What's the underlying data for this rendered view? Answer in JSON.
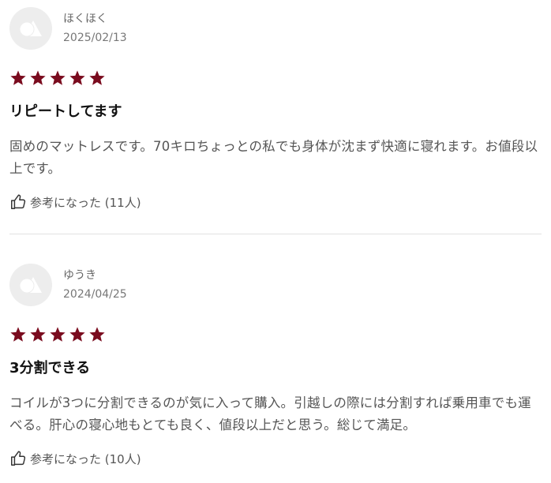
{
  "colors": {
    "star": "#7a0b1e",
    "avatar_bg": "#ededed",
    "avatar_icon": "#ffffff"
  },
  "reviews": [
    {
      "user": "ほくほく",
      "date": "2025/02/13",
      "rating": 5,
      "title": "リピートしてます",
      "body": "固めのマットレスです。70キロちょっとの私でも身体が沈まず快適に寝れます。お値段以上です。",
      "helpful_label": "参考になった (11人)",
      "icons": {
        "avatar": "default-avatar-icon",
        "helpful": "thumbs-up-icon"
      }
    },
    {
      "user": "ゆうき",
      "date": "2024/04/25",
      "rating": 5,
      "title": "3分割できる",
      "body": "コイルが3つに分割できるのが気に入って購入。引越しの際には分割すれば乗用車でも運べる。肝心の寝心地もとても良く、値段以上だと思う。総じて満足。",
      "helpful_label": "参考になった (10人)",
      "icons": {
        "avatar": "default-avatar-icon",
        "helpful": "thumbs-up-icon"
      }
    }
  ]
}
